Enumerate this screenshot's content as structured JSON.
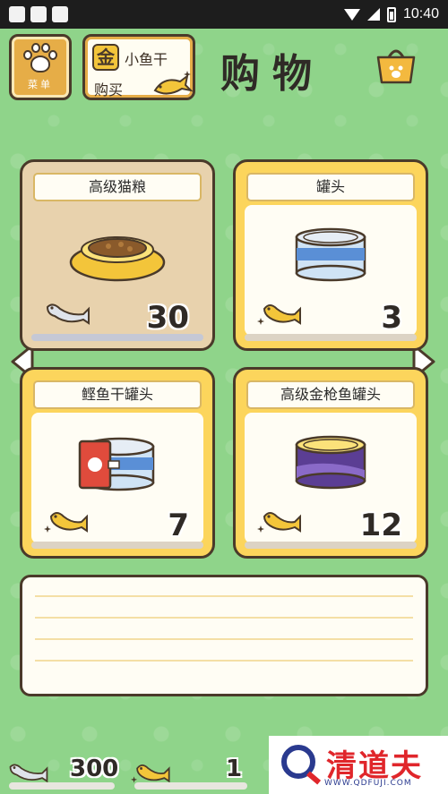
{
  "status_bar": {
    "time": "10:40"
  },
  "header": {
    "menu_label": "菜单",
    "gold_coin_label": "金",
    "gold_line1": "小鱼干",
    "gold_line2": "购买",
    "title": "购物"
  },
  "items": [
    {
      "name": "高级猫粮",
      "price": "30",
      "currency": "silver-fish",
      "selected": true
    },
    {
      "name": "罐头",
      "price": "3",
      "currency": "gold-fish",
      "selected": false
    },
    {
      "name": "鲣鱼干罐头",
      "price": "7",
      "currency": "gold-fish",
      "selected": false
    },
    {
      "name": "高级金枪鱼罐头",
      "price": "12",
      "currency": "gold-fish",
      "selected": false
    }
  ],
  "message": "",
  "currency": {
    "silver_fish": "300",
    "gold_fish": "1"
  },
  "watermark": {
    "text": "清道夫",
    "url": "WWW.QDFUJI.COM"
  },
  "colors": {
    "background": "#8fd48a",
    "card": "#fcd55c",
    "accent": "#e6ad47"
  }
}
